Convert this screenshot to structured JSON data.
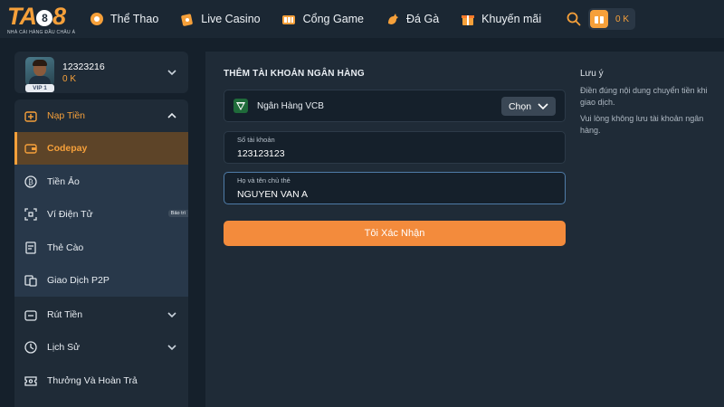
{
  "brand": {
    "logo_text": "TA88",
    "tagline": "NHÀ CÁI HÀNG ĐẦU CHÂU Á",
    "accent": "#f6a03a"
  },
  "nav": {
    "items": [
      {
        "label": "Thể Thao",
        "icon": "soccer-ball-icon"
      },
      {
        "label": "Live Casino",
        "icon": "card-icon"
      },
      {
        "label": "Cổng Game",
        "icon": "game-portal-icon"
      },
      {
        "label": "Đá Gà",
        "icon": "rooster-icon"
      },
      {
        "label": "Khuyến mãi",
        "icon": "gift-icon"
      }
    ],
    "wallet_balance": "0 K"
  },
  "profile": {
    "username": "12323216",
    "balance": "0 K",
    "vip": "VIP 1"
  },
  "sidebar": {
    "deposit": {
      "label": "Nạp Tiền",
      "icon": "deposit-icon"
    },
    "sub_items": [
      {
        "label": "Codepay",
        "icon": "wallet-icon",
        "active": true
      },
      {
        "label": "Tiền Ảo",
        "icon": "crypto-coin-icon"
      },
      {
        "label": "Ví Điện Tử",
        "icon": "qr-scan-icon",
        "badge": "Bảo trì"
      },
      {
        "label": "Thẻ Cào",
        "icon": "scratch-card-icon"
      },
      {
        "label": "Giao Dịch P2P",
        "icon": "p2p-transfer-icon"
      }
    ],
    "withdraw": {
      "label": "Rút Tiền",
      "icon": "withdraw-icon"
    },
    "history": {
      "label": "Lịch Sử",
      "icon": "history-icon"
    },
    "rewards": {
      "label": "Thưởng Và Hoàn Trả",
      "icon": "reward-ticket-icon"
    }
  },
  "form": {
    "title": "THÊM TÀI KHOẢN NGÂN HÀNG",
    "bank_name": "Ngân Hàng VCB",
    "choose_label": "Chọn",
    "account_number": {
      "label": "Số tài khoản",
      "value": "123123123"
    },
    "holder_name": {
      "label": "Họ và tên chủ thẻ",
      "value": "NGUYEN VAN A"
    },
    "confirm_label": "Tôi Xác Nhận"
  },
  "notes": {
    "title": "Lưu ý",
    "items": [
      "Điền đúng nội dung chuyển tiền khi giao dịch.",
      "Vui lòng không lưu tài khoản ngân hàng."
    ]
  }
}
